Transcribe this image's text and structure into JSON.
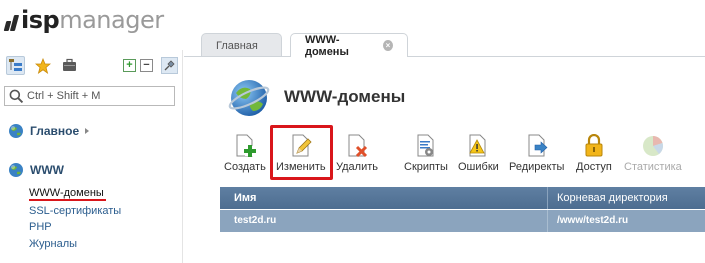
{
  "logo": {
    "part1": "isp",
    "part2": "manager"
  },
  "sidebar": {
    "search_placeholder": "Ctrl + Shift + M",
    "sections": [
      {
        "label": "Главное"
      },
      {
        "label": "WWW"
      }
    ],
    "www_items": [
      {
        "label": "WWW-домены",
        "active": true
      },
      {
        "label": "SSL-сертификаты"
      },
      {
        "label": "PHP"
      },
      {
        "label": "Журналы"
      }
    ]
  },
  "tabs": [
    {
      "label": "Главная"
    },
    {
      "label": "WWW-домены"
    }
  ],
  "page": {
    "title": "WWW-домены"
  },
  "toolbar": {
    "create": "Создать",
    "edit": "Изменить",
    "delete": "Удалить",
    "scripts": "Скрипты",
    "errors": "Ошибки",
    "redirects": "Редиректы",
    "access": "Доступ",
    "stats": "Статистика"
  },
  "table": {
    "columns": [
      "Имя",
      "Корневая директория"
    ],
    "rows": [
      [
        "test2d.ru",
        "/www/test2d.ru"
      ]
    ]
  },
  "colors": {
    "accent": "#d9161b",
    "header_bg": "#5f7fa2",
    "selected_row_bg": "#8ba4be"
  }
}
